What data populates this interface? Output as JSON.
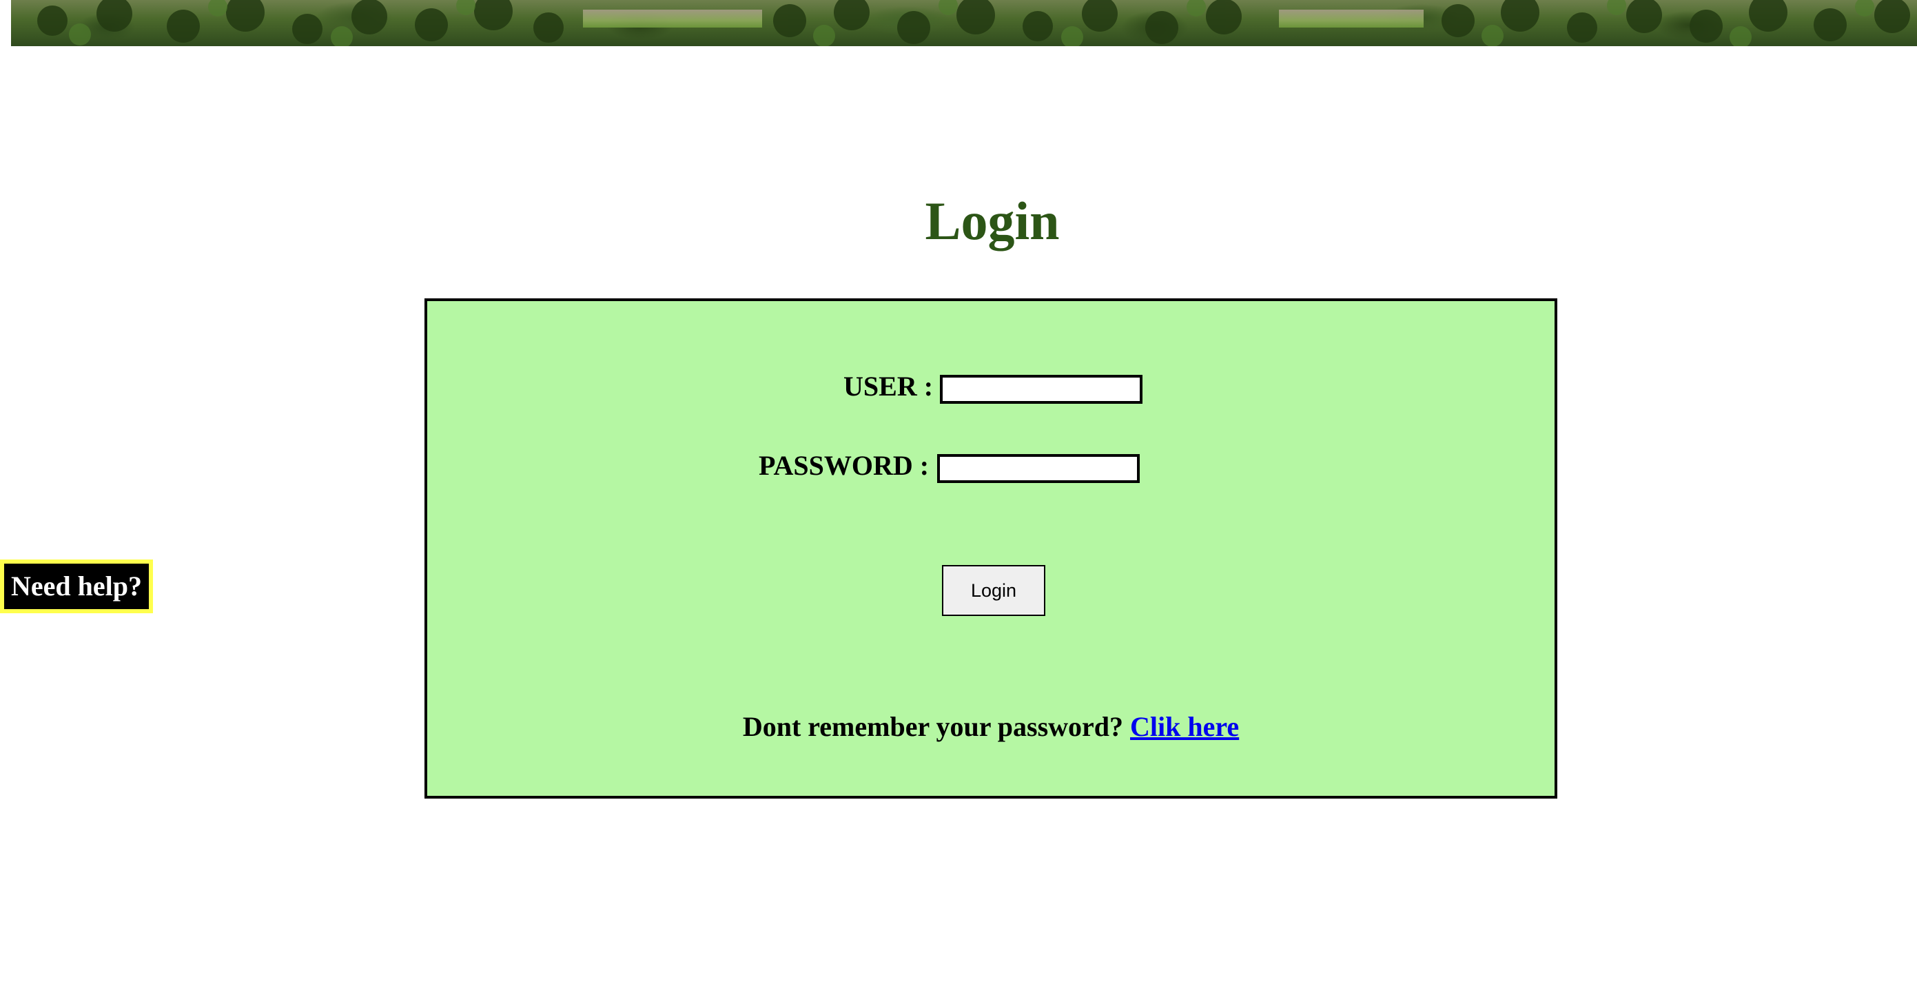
{
  "banner": {
    "icon": "palm-forest-banner-image"
  },
  "page": {
    "title": "Login"
  },
  "form": {
    "user_label": "USER :",
    "user_value": "",
    "password_label": "PASSWORD :",
    "password_value": "",
    "login_button": "Login",
    "forgot_text": "Dont remember your password?",
    "forgot_link": "Clik here"
  },
  "help": {
    "label": "Need help?"
  },
  "colors": {
    "title": "#2c5516",
    "box_background": "#b5f7a3",
    "link": "#0000ee",
    "help_border": "#ffff4d",
    "help_background": "#000000"
  }
}
